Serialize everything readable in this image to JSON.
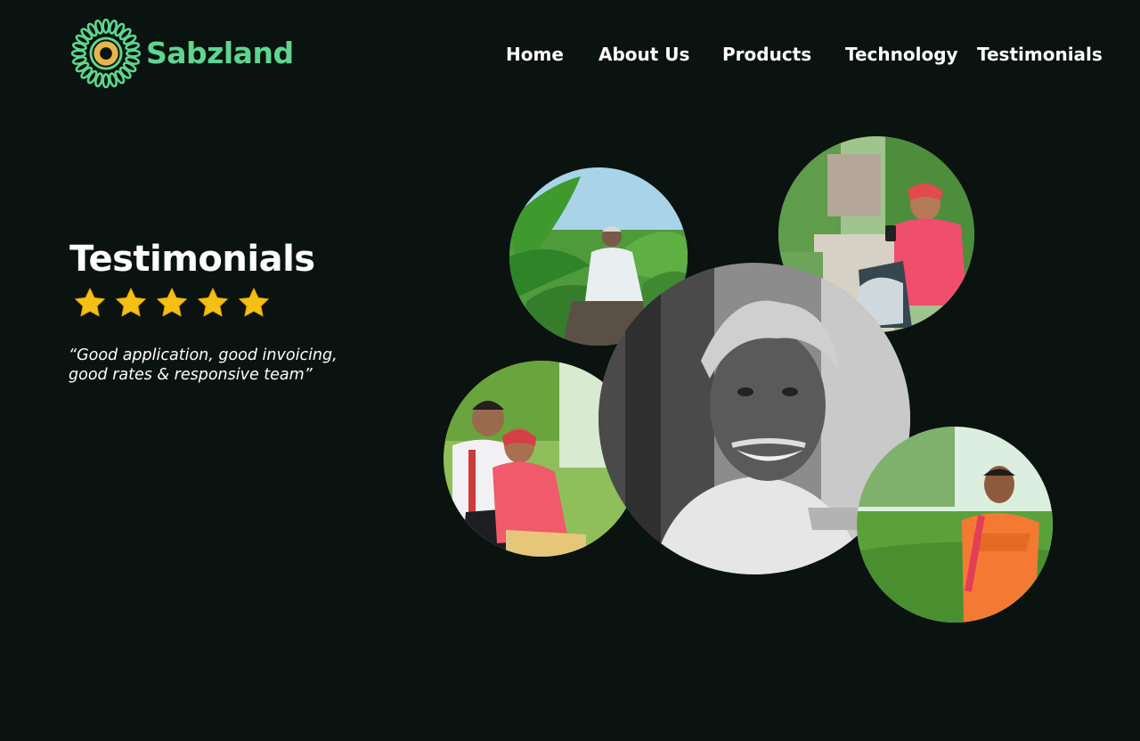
{
  "brand": {
    "name": "Sabzland",
    "logo_icon": "sunflower-logo-icon",
    "color": "#5dd68f",
    "accent": "#e8b54a"
  },
  "nav": {
    "home": "Home",
    "about": "About Us",
    "products": "Products",
    "technology": "Technology",
    "testimonials": "Testimonials"
  },
  "hero": {
    "title": "Testimonials",
    "rating": 5,
    "rating_max": 5,
    "star_color": "#f5bf14",
    "quote": "“Good application, good invoicing, good rates & responsive team”"
  },
  "photos": [
    {
      "name": "farmer-in-banana-field-photo",
      "subject": "elderly farmer sitting in banana plantation"
    },
    {
      "name": "farmer-on-motorbike-photo",
      "subject": "young man with red turban on motorbike using phone"
    },
    {
      "name": "elderly-farmer-portrait-photo",
      "subject": "black and white portrait of smiling elderly man"
    },
    {
      "name": "farmers-with-phones-photo",
      "subject": "two men looking at phones in a field"
    },
    {
      "name": "farmer-in-orange-kurta-photo",
      "subject": "man in orange kurta standing in crop field"
    }
  ],
  "colors": {
    "background": "#0a130f",
    "text": "#ffffff"
  }
}
